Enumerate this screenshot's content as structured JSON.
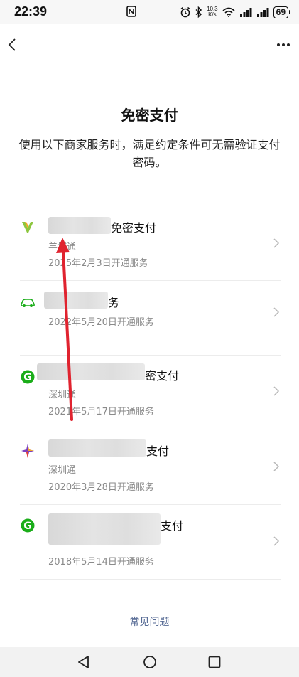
{
  "status_bar": {
    "time": "22:39",
    "net_speed_value": "10.3",
    "net_speed_unit": "K/s",
    "battery": "69"
  },
  "header": {
    "title": "免密支付",
    "description": "使用以下商家服务时，满足约定条件可无需验证支付密码。"
  },
  "services": [
    {
      "icon": "v-logo-icon",
      "name": "免密支付",
      "merchant": "羊城通",
      "date": "2025年2月3日开通服务"
    },
    {
      "icon": "car-icon",
      "name": "务",
      "merchant": "",
      "date": "2022年5月20日开通服务"
    },
    {
      "icon": "g-logo-icon",
      "name": "密支付",
      "merchant": "深圳通",
      "date": "2021年5月17日开通服务"
    },
    {
      "icon": "star-logo-icon",
      "name": "支付",
      "merchant": "深圳通",
      "date": "2020年3月28日开通服务"
    },
    {
      "icon": "g-logo-icon",
      "name": "支付",
      "merchant": "",
      "date": "2018年5月14日开通服务"
    }
  ],
  "footer": {
    "faq": "常见问题"
  },
  "colors": {
    "link": "#576b95",
    "annotation_arrow": "#e0232f",
    "green": "#1aad19"
  }
}
